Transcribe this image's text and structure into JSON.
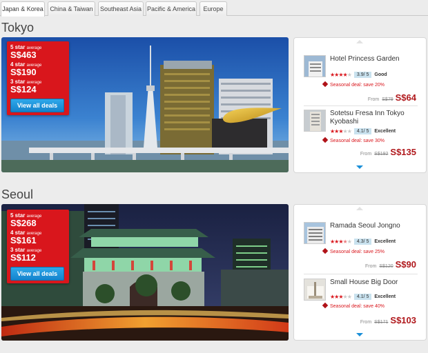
{
  "tabs": [
    {
      "label": "Japan & Korea",
      "active": true
    },
    {
      "label": "China & Taiwan",
      "active": false
    },
    {
      "label": "Southeast Asia",
      "active": false
    },
    {
      "label": "Pacific & America",
      "active": false
    },
    {
      "label": "Europe",
      "active": false
    }
  ],
  "colors": {
    "accent_red": "#d9161c",
    "button_blue": "#1a8fd8",
    "score_bg": "#c9e2ef"
  },
  "cities": [
    {
      "name": "Tokyo",
      "tiers": [
        {
          "label": "5 star",
          "suffix": "average",
          "price": "S$463"
        },
        {
          "label": "4 star",
          "suffix": "average",
          "price": "S$190"
        },
        {
          "label": "3 star",
          "suffix": "average",
          "price": "S$124"
        }
      ],
      "button": "View all deals",
      "hotels": [
        {
          "name": "Hotel Princess Garden",
          "stars": 4,
          "score": "3.9/ 5",
          "rating": "Good",
          "deal": "Seasonal deal: save 20%",
          "from": "From",
          "old_price": "S$79",
          "price": "S$64"
        },
        {
          "name": "Sotetsu Fresa Inn Tokyo Kyobashi",
          "stars": 3,
          "score": "4.1/ 5",
          "rating": "Excellent",
          "deal": "Seasonal deal: save 30%",
          "from": "From",
          "old_price": "S$192",
          "price": "S$135"
        }
      ]
    },
    {
      "name": "Seoul",
      "tiers": [
        {
          "label": "5 star",
          "suffix": "average",
          "price": "S$268"
        },
        {
          "label": "4 star",
          "suffix": "average",
          "price": "S$161"
        },
        {
          "label": "3 star",
          "suffix": "average",
          "price": "S$112"
        }
      ],
      "button": "View all deals",
      "hotels": [
        {
          "name": "Ramada Seoul Jongno",
          "stars": 3.5,
          "score": "4.3/ 5",
          "rating": "Excellent",
          "deal": "Seasonal deal: save 25%",
          "from": "From",
          "old_price": "S$120",
          "price": "S$90"
        },
        {
          "name": "Small House Big Door",
          "stars": 3,
          "score": "4.1/ 5",
          "rating": "Excellent",
          "deal": "Seasonal deal: save 40%",
          "from": "From",
          "old_price": "S$171",
          "price": "S$103"
        }
      ]
    }
  ]
}
